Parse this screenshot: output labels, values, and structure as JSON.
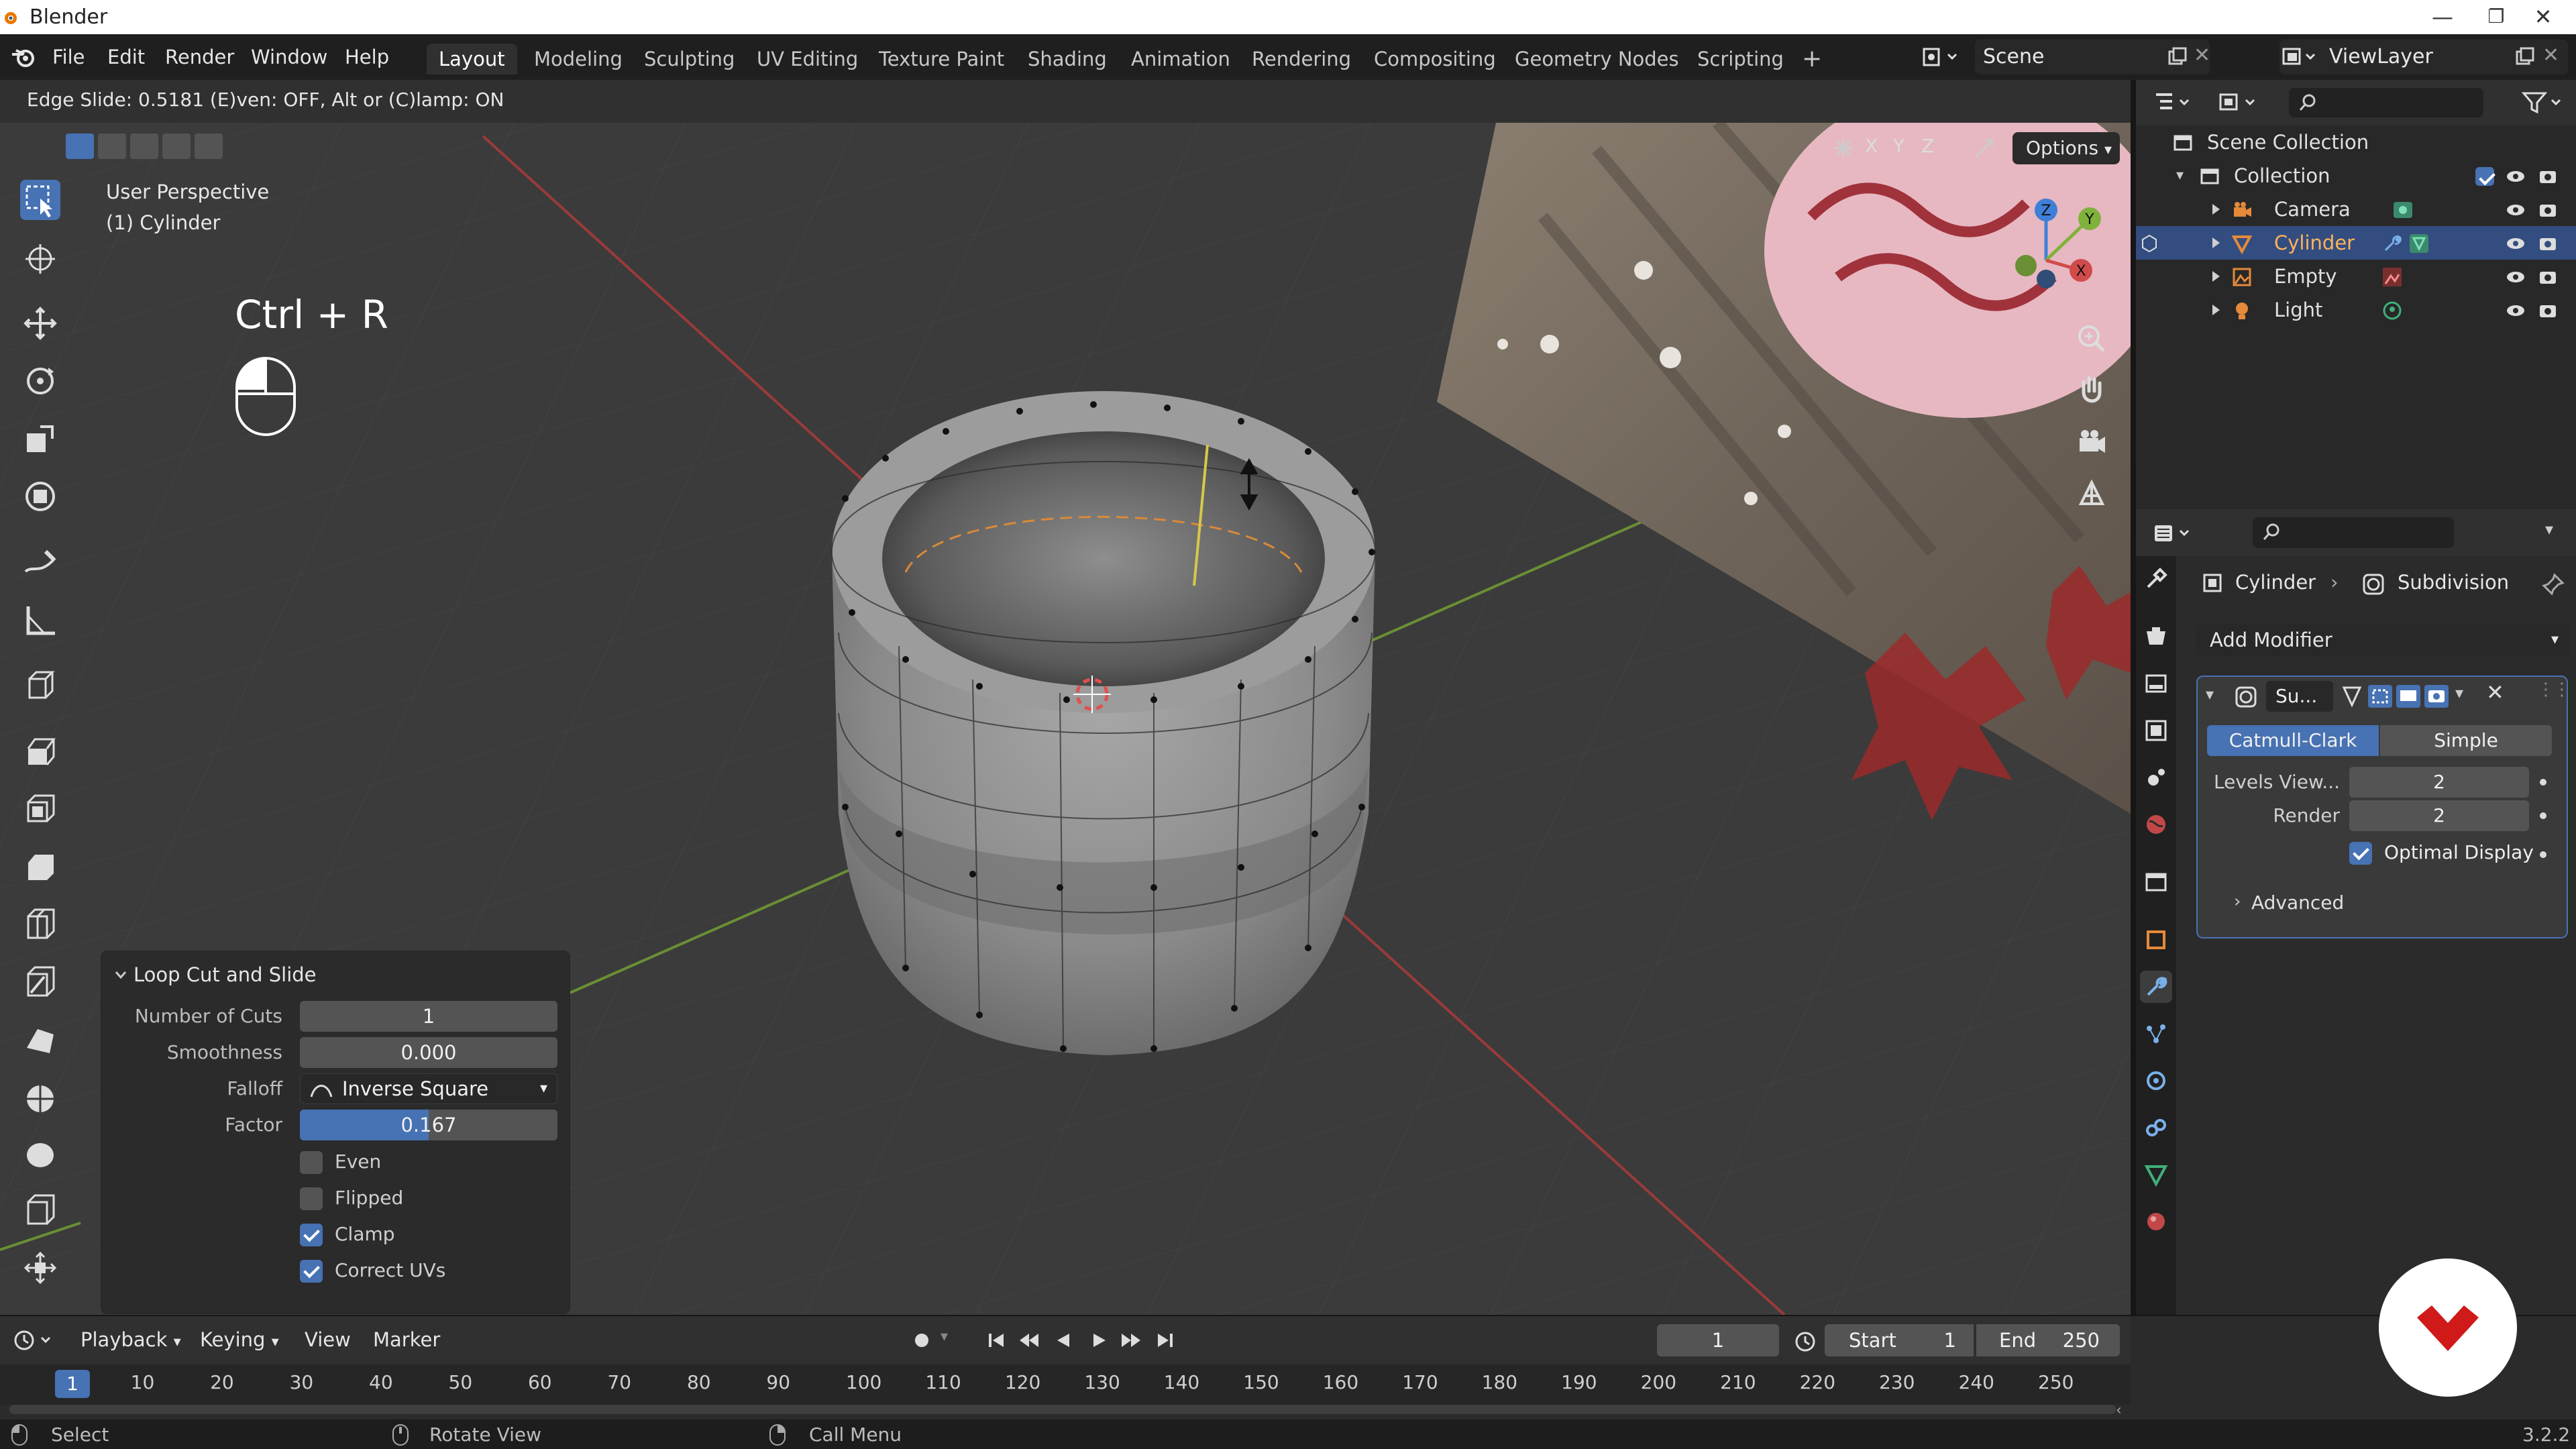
{
  "window": {
    "title": "Blender"
  },
  "menu": [
    "File",
    "Edit",
    "Render",
    "Window",
    "Help"
  ],
  "workspaces": {
    "tabs": [
      "Layout",
      "Modeling",
      "Sculpting",
      "UV Editing",
      "Texture Paint",
      "Shading",
      "Animation",
      "Rendering",
      "Compositing",
      "Geometry Nodes",
      "Scripting"
    ],
    "active": "Layout",
    "add": "+"
  },
  "scene": {
    "name": "Scene"
  },
  "view_layer": {
    "name": "ViewLayer"
  },
  "header_status": "Edge Slide: 0.5181 (E)ven: OFF, Alt or (C)lamp: ON",
  "viewport": {
    "perspective": "User Perspective",
    "object": "(1) Cylinder",
    "axis_buttons": [
      "X",
      "Y",
      "Z"
    ],
    "options_label": "Options",
    "gizmo_axes": {
      "z": "Z",
      "y": "Y",
      "x": "X"
    },
    "key_hint": "Ctrl + R"
  },
  "operator_panel": {
    "title": "Loop Cut and Slide",
    "number_of_cuts_label": "Number of Cuts",
    "number_of_cuts": "1",
    "smoothness_label": "Smoothness",
    "smoothness": "0.000",
    "falloff_label": "Falloff",
    "falloff": "Inverse Square",
    "factor_label": "Factor",
    "factor": "0.167",
    "factor_fraction": 0.5,
    "checks": [
      {
        "label": "Even",
        "checked": false
      },
      {
        "label": "Flipped",
        "checked": false
      },
      {
        "label": "Clamp",
        "checked": true
      },
      {
        "label": "Correct UVs",
        "checked": true
      }
    ]
  },
  "outliner": {
    "scene_collection": "Scene Collection",
    "collection": "Collection",
    "items": [
      {
        "name": "Camera",
        "icon": "camera-icon"
      },
      {
        "name": "Cylinder",
        "icon": "mesh-icon",
        "selected": true
      },
      {
        "name": "Empty",
        "icon": "image-empty-icon"
      },
      {
        "name": "Light",
        "icon": "light-icon"
      }
    ]
  },
  "properties": {
    "object_name": "Cylinder",
    "modifier_name": "Subdivision",
    "add_modifier": "Add Modifier",
    "modifier_short": "Su...",
    "subdiv_types": [
      "Catmull-Clark",
      "Simple"
    ],
    "levels_viewport_label": "Levels View...",
    "levels_viewport": "2",
    "render_label": "Render",
    "render": "2",
    "optimal_display_label": "Optimal Display",
    "optimal_display": true,
    "advanced_label": "Advanced"
  },
  "timeline": {
    "menus": [
      "Playback",
      "Keying",
      "View",
      "Marker"
    ],
    "current_frame": "1",
    "start_label": "Start",
    "start": "1",
    "end_label": "End",
    "end": "250",
    "ruler_labels": [
      "1",
      "10",
      "20",
      "30",
      "40",
      "50",
      "60",
      "70",
      "80",
      "90",
      "100",
      "110",
      "120",
      "130",
      "140",
      "150",
      "160",
      "170",
      "180",
      "190",
      "200",
      "210",
      "220",
      "230",
      "240",
      "250"
    ]
  },
  "statusbar": {
    "select": "Select",
    "rotate_view": "Rotate View",
    "call_menu": "Call Menu",
    "version": "3.2.2"
  },
  "colors": {
    "accent": "#4772b3",
    "x_axis": "#d14b4b",
    "y_axis": "#7fb23a",
    "z_axis": "#3f7fd8",
    "active_object": "#ffb35a"
  }
}
